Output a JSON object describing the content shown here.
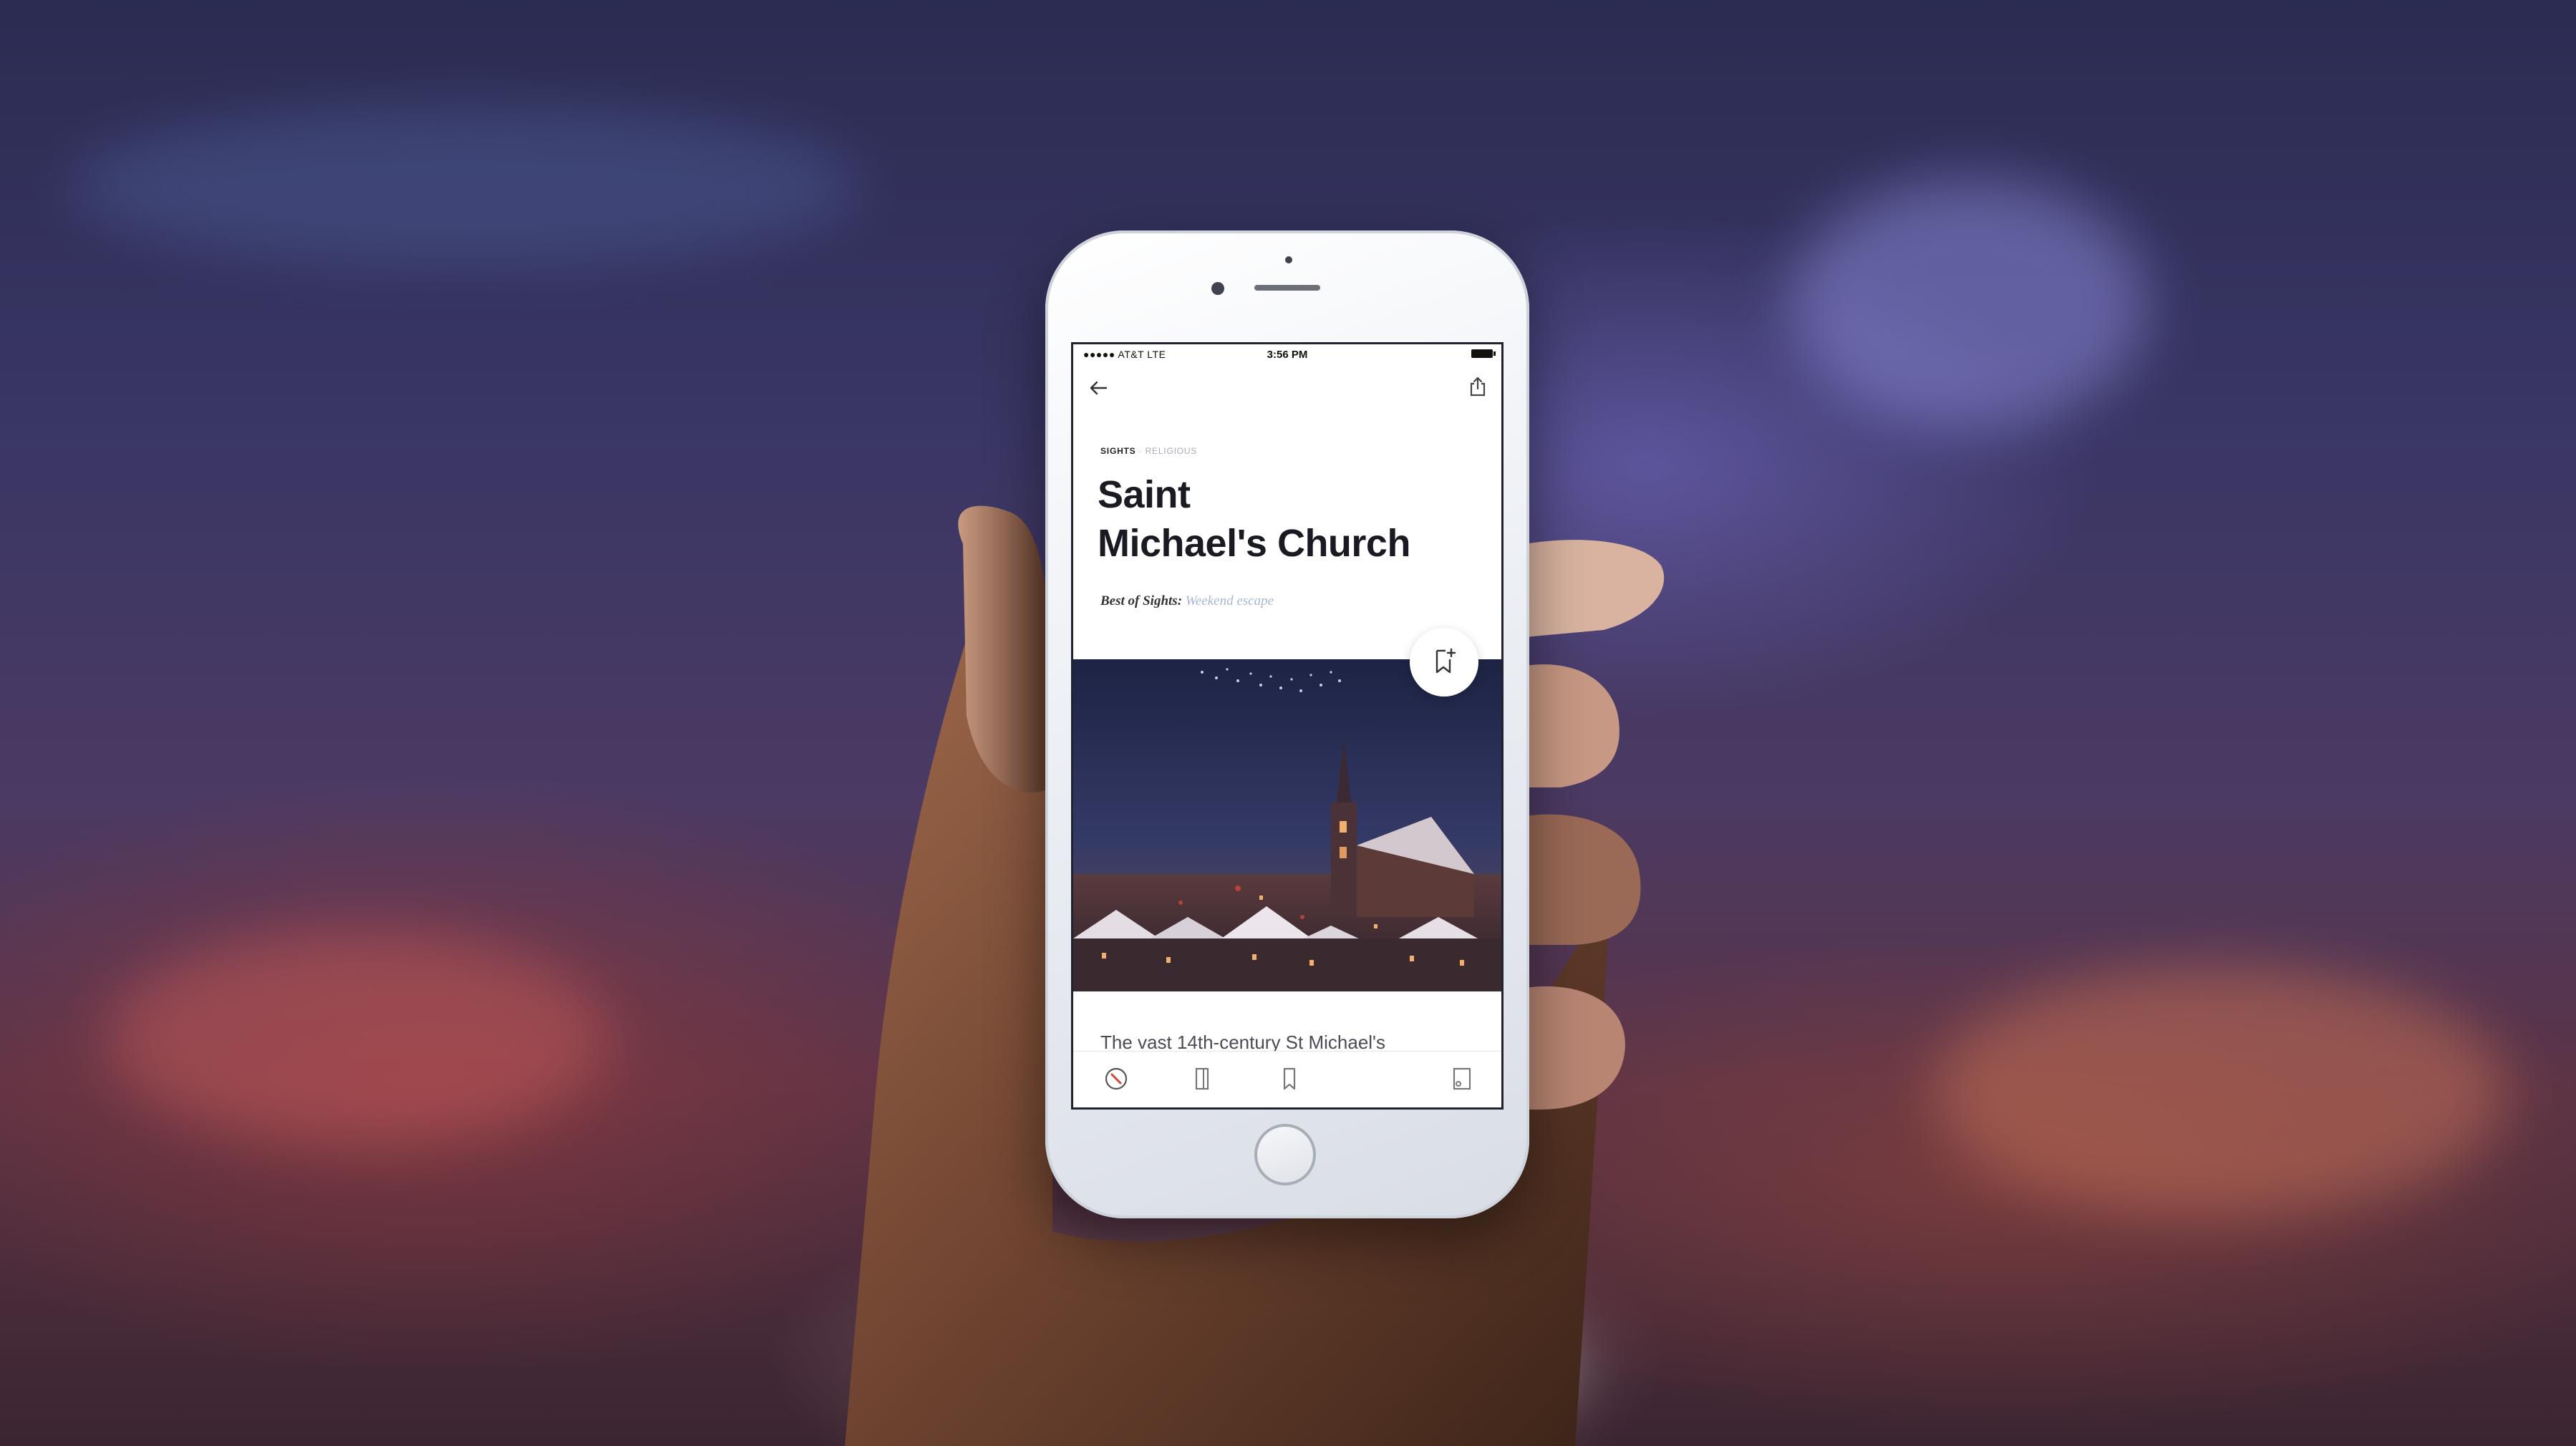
{
  "status_bar": {
    "carrier": "●●●●● AT&T  LTE",
    "time": "3:56 PM"
  },
  "article": {
    "category": "SIGHTS",
    "separator": "·",
    "subcategory": "RELIGIOUS",
    "title_line1": "Saint",
    "title_line2": "Michael's Church",
    "list_label": "Best of Sights:",
    "list_link": "Weekend escape",
    "body_preview": "The vast 14th-century St Michael's"
  },
  "icons": {
    "back": "arrow-left-icon",
    "share": "share-icon",
    "bookmark_add": "bookmark-add-icon",
    "tab_explore": "compass-icon",
    "tab_guides": "book-icon",
    "tab_saved": "bookmark-icon",
    "tab_profile": "profile-card-icon"
  },
  "colors": {
    "accent": "#d0453a",
    "link": "#a9b6d6",
    "title": "#1a1b22"
  }
}
